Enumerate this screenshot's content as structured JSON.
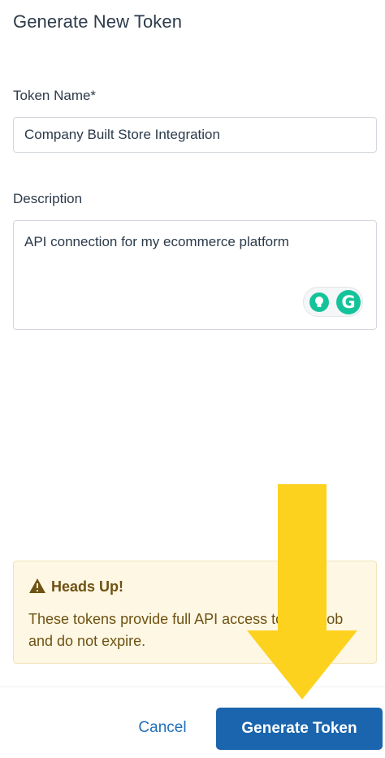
{
  "dialog": {
    "title": "Generate New Token"
  },
  "form": {
    "token_name_label": "Token Name*",
    "token_name_value": "Company Built Store Integration",
    "description_label": "Description",
    "description_value": "API connection for my ecommerce platform"
  },
  "grammarly": {
    "bulb_icon": "lightbulb-icon",
    "logo_letter": "G",
    "brand_color": "#15c39a"
  },
  "alert": {
    "heading": "Heads Up!",
    "body": "These tokens provide full API access to ShipBob and do not expire.",
    "icon": "warning-triangle-icon",
    "background": "#fdf7e3",
    "text_color": "#6e5213"
  },
  "footer": {
    "cancel_label": "Cancel",
    "generate_label": "Generate Token",
    "primary_color": "#1a65ad"
  },
  "annotation": {
    "arrow_color": "#fdd21f",
    "arrow_icon": "down-arrow-icon"
  }
}
